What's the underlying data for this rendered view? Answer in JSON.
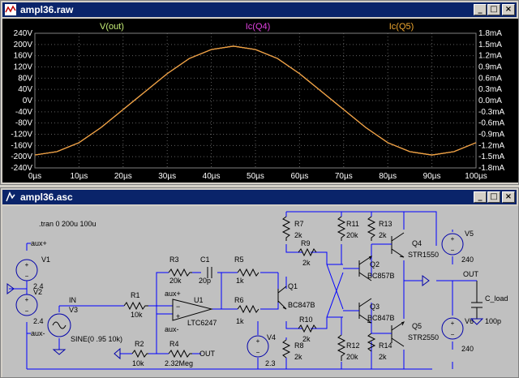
{
  "waveform_window": {
    "title": "ampl36.raw",
    "buttons": {
      "minimize": "_",
      "maximize": "□",
      "close": "×"
    },
    "plot_bg": "#000000",
    "traces": [
      {
        "name": "V(out)",
        "color": "#c8f078"
      },
      {
        "name": "Ic(Q4)",
        "color": "#e040e0"
      },
      {
        "name": "Ic(Q5)",
        "color": "#f0a830"
      }
    ],
    "left_axis_ticks": [
      "240V",
      "200V",
      "160V",
      "120V",
      "80V",
      "40V",
      "0V",
      "-40V",
      "-80V",
      "-120V",
      "-160V",
      "-200V",
      "-240V"
    ],
    "right_axis_ticks": [
      "1.8mA",
      "1.5mA",
      "1.2mA",
      "0.9mA",
      "0.6mA",
      "0.3mA",
      "0.0mA",
      "-0.3mA",
      "-0.6mA",
      "-0.9mA",
      "-1.2mA",
      "-1.5mA",
      "-1.8mA"
    ],
    "x_axis_ticks": [
      "0µs",
      "10µs",
      "20µs",
      "30µs",
      "40µs",
      "50µs",
      "60µs",
      "70µs",
      "80µs",
      "90µs",
      "100µs"
    ]
  },
  "chart_data": {
    "type": "line",
    "x_unit": "µs",
    "xlim": [
      0,
      100
    ],
    "ylim_left": [
      -240,
      240
    ],
    "ylim_right": [
      -1.8,
      1.8
    ],
    "grid": true,
    "legend": "top",
    "series": [
      {
        "name": "V(out)",
        "axis": "left",
        "x": [
          0,
          5,
          10,
          15,
          20,
          25,
          30,
          35,
          40,
          45,
          50,
          55,
          60,
          65,
          70,
          75,
          80,
          85,
          90,
          95,
          100
        ],
        "values": [
          -194,
          -182,
          -150,
          -96,
          -32,
          32,
          96,
          150,
          182,
          194,
          182,
          150,
          96,
          32,
          -32,
          -96,
          -150,
          -182,
          -194,
          -182,
          -150
        ]
      },
      {
        "name": "Ic(Q4)",
        "axis": "left",
        "x": [
          0,
          5,
          10,
          15,
          20,
          25,
          30,
          35,
          40,
          45,
          50,
          55,
          60,
          65,
          70,
          75,
          80,
          85,
          90,
          95,
          100
        ],
        "values": [
          -194,
          -182,
          -150,
          -96,
          -32,
          32,
          96,
          150,
          182,
          194,
          182,
          150,
          96,
          32,
          -32,
          -96,
          -150,
          -182,
          -194,
          -182,
          -150
        ]
      },
      {
        "name": "Ic(Q5)",
        "axis": "left",
        "x": [
          0,
          5,
          10,
          15,
          20,
          25,
          30,
          35,
          40,
          45,
          50,
          55,
          60,
          65,
          70,
          75,
          80,
          85,
          90,
          95,
          100
        ],
        "values": [
          -194,
          -182,
          -150,
          -96,
          -32,
          32,
          96,
          150,
          182,
          194,
          182,
          150,
          96,
          32,
          -32,
          -96,
          -150,
          -182,
          -194,
          -182,
          -150
        ]
      }
    ]
  },
  "schematic_window": {
    "title": "ampl36.asc",
    "buttons": {
      "minimize": "_",
      "maximize": "□",
      "close": "×"
    },
    "directive": ".tran 0 200u 100u",
    "labels": {
      "aux_plus_net": "aux+",
      "aux_minus_net": "aux-",
      "in_net": "IN",
      "out_net": "OUT",
      "out_label": "OUT",
      "c_load": "C_load",
      "c_load_val": "100p",
      "u1": "U1",
      "u1_val": "LTC6247",
      "u1_auxp": "aux+",
      "u1_auxm": "aux-",
      "v1": "V1",
      "v1_val": "2.4",
      "v2": "V2",
      "v2_val": "2.4",
      "v3": "V3",
      "v3_val": "SINE(0 .95 10k)",
      "v4": "V4",
      "v4_val": "2.3",
      "v5": "V5",
      "v5_val": "240",
      "v6": "V6",
      "v6_val": "240",
      "r1": "R1",
      "r1_val": "10k",
      "r2": "R2",
      "r2_val": "10k",
      "r3": "R3",
      "r3_val": "20k",
      "r4": "R4",
      "r4_val": "2.32Meg",
      "r5": "R5",
      "r5_val": "1k",
      "r6": "R6",
      "r6_val": "1k",
      "r7": "R7",
      "r7_val": "2k",
      "r8": "R8",
      "r8_val": "2k",
      "r9": "R9",
      "r9_val": "2k",
      "r10": "R10",
      "r10_val": "2k",
      "r11": "R11",
      "r11_val": "20k",
      "r12": "R12",
      "r12_val": "20k",
      "r13": "R13",
      "r13_val": "2k",
      "r14": "R14",
      "r14_val": "2k",
      "c1": "C1",
      "c1_val": "20p",
      "q1": "Q1",
      "q1_val": "BC847B",
      "q2": "Q2",
      "q2_val": "BC857B",
      "q3": "Q3",
      "q3_val": "BC847B",
      "q4": "Q4",
      "q4_val": "STR1550",
      "q5": "Q5",
      "q5_val": "STR2550"
    }
  }
}
